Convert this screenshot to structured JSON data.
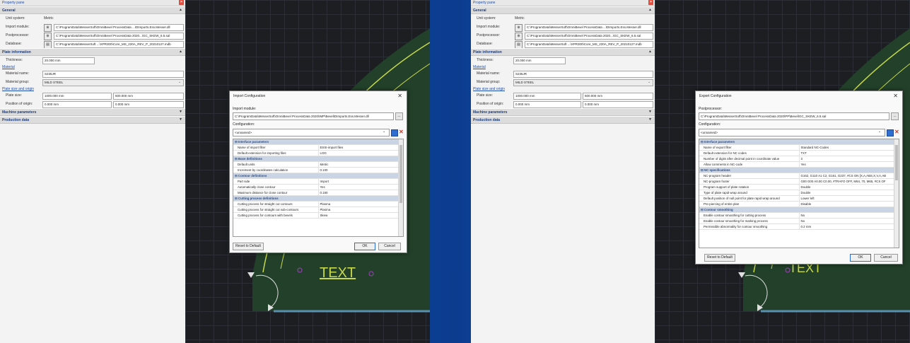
{
  "pane": {
    "title": "Property pane",
    "sections": {
      "general": "General",
      "plate_information": "Plate information",
      "machine_parameters": "Machine parameters",
      "production_data": "Production data"
    },
    "links": {
      "material": "Material",
      "plate_size_and_origin": "Plate size and origin"
    },
    "labels": {
      "unit_system": "Unit system:",
      "import_module": "Import module:",
      "postprocessor": "Postprocessor:",
      "database": "Database:",
      "thickness": "Thickness:",
      "material_name": "Material name:",
      "material_group": "Material group:",
      "plate_size": "Plate size:",
      "position_of_origin": "Position of origin:"
    },
    "values": {
      "unit_system": "Metric",
      "import_module": "C:\\ProgramData\\MesserSoft\\OmniBevel ProcessData ...\\DImports.Ess.Messer.dll",
      "postprocessor": "C:\\ProgramData\\MesserSoft\\OmniBevel ProcessData 2020...\\GC_SKEW_6.5.sal",
      "database": "C:\\ProgramData\\MesserSoft ...\\XPR300\\Core_MS_220A_REV_P_20210127.mdb",
      "thickness": "20.000 mm",
      "material_name": "S235JR",
      "material_group": "MILD STEEL",
      "plate_width": "1000.000 mm",
      "plate_height": "600.000 mm",
      "origin_x": "0.000 mm",
      "origin_y": "0.000 mm"
    }
  },
  "import_dialog": {
    "title": "Import Configuration",
    "module_label": "Import module:",
    "module_path": "C:\\ProgramData\\MesserSoft\\OmniBevel ProcessData 2020\\IMP\\Bevel\\DImports.Ess.Messer.dll",
    "config_label": "Configuration:",
    "config_value": "<unnamed>",
    "rows": [
      {
        "header": true,
        "label": "Interface parameters"
      },
      {
        "label": "Name of import filter",
        "value": "ESSI-import files"
      },
      {
        "label": "Default extension for importing files",
        "value": "LOG"
      },
      {
        "header": true,
        "label": "Base definitions"
      },
      {
        "label": "Default units",
        "value": "Metric"
      },
      {
        "label": "Increment by coordinates calculation",
        "value": "0.100"
      },
      {
        "header": true,
        "label": "Contour definitions"
      },
      {
        "label": "Part side",
        "value": "Import"
      },
      {
        "label": "Automatically close contour",
        "value": "Yes"
      },
      {
        "label": "Maximum distance for close contour",
        "value": "0.150"
      },
      {
        "header": true,
        "label": "Cutting process definitions"
      },
      {
        "label": "Cutting process for straight cut contours",
        "value": "Plasma"
      },
      {
        "label": "Cutting process for straight cut sub-contours",
        "value": "Plasma"
      },
      {
        "label": "Cutting process for contours with bevels",
        "value": "Skew"
      }
    ],
    "reset_label": "Reset to Default",
    "ok_label": "OK",
    "cancel_label": "Cancel"
  },
  "export_dialog": {
    "title": "Export Configuration",
    "module_label": "Postprocessor:",
    "module_path": "C:\\ProgramData\\MesserSoft\\OmniBevel ProcessData 2020\\PP\\Bevel\\GC_SKEW_6.5.sal",
    "config_label": "Configuration:",
    "config_value": "<unnamed>",
    "rows": [
      {
        "header": true,
        "label": "Interface parameters"
      },
      {
        "label": "Name of export filter",
        "value": "Standard NC-Codes"
      },
      {
        "label": "Default extension for NC codes",
        "value": "TXT"
      },
      {
        "label": "Number of digits after decimal point in coordinate value",
        "value": "3"
      },
      {
        "label": "Allow comments in NC-code",
        "value": "Yes"
      },
      {
        "header": true,
        "label": "NC specifications"
      },
      {
        "label": "NC-program header",
        "value": "G162, G110 A1 C2, G161, G237, #CS ON [X,A,ABS,X,V,A,AB"
      },
      {
        "label": "NC-program footer",
        "value": "G00 G00 A0.00 C0.00, #TRAFO OFF, M64, 70, M65, #CS OF"
      },
      {
        "label": "Program support of plate rotation",
        "value": "Double"
      },
      {
        "label": "Type of plate rapid wrap around",
        "value": "Double"
      },
      {
        "label": "Default position of null point for plate rapid wrap around",
        "value": "Lower left"
      },
      {
        "label": "Pre-piercing of entire plan",
        "value": "Disable"
      },
      {
        "header": true,
        "label": "Contour smoothing"
      },
      {
        "label": "Enable contour smoothing for cutting process",
        "value": "No"
      },
      {
        "label": "Enable contour smoothing for marking process",
        "value": "No"
      },
      {
        "label": "Permissible abnormality for contour smoothing",
        "value": "0.2 mm"
      }
    ],
    "reset_label": "Reset to Default",
    "ok_label": "OK",
    "cancel_label": "Cancel"
  },
  "cad": {
    "text_label": "TEXT",
    "outline_color": "#c7d84a",
    "plate_color": "#22402a",
    "marker_color": "#a040c0"
  }
}
